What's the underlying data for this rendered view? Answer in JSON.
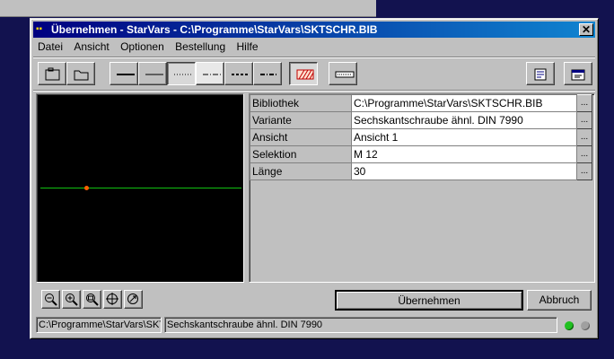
{
  "window": {
    "title": "Übernehmen - StarVars - C:\\Programme\\StarVars\\SKTSCHR.BIB",
    "close_label": "✕"
  },
  "menu": [
    "Datei",
    "Ansicht",
    "Optionen",
    "Bestellung",
    "Hilfe"
  ],
  "toolbar": {
    "buttons": [
      "new-icon",
      "open-icon",
      "line-thick-icon",
      "line-thin-icon",
      "line-dotted-icon",
      "line-dashdot-icon",
      "line-dashed-icon",
      "line-dashdot2-icon",
      "hatch-icon",
      "dimension-icon"
    ],
    "pressed": [
      "line-dotted-icon",
      "hatch-icon"
    ],
    "right_buttons": [
      "export-icon",
      "properties-icon"
    ]
  },
  "viewer": {
    "background": "#000000",
    "line_color": "#10c010",
    "point_color": "#ff6000"
  },
  "properties": [
    {
      "label": "Bibliothek",
      "value": "C:\\Programme\\StarVars\\SKTSCHR.BIB",
      "button": "..."
    },
    {
      "label": "Variante",
      "value": "Sechskantschraube ähnl. DIN 7990",
      "button": "..."
    },
    {
      "label": "Ansicht",
      "value": "Ansicht 1",
      "button": "..."
    },
    {
      "label": "Selektion",
      "value": "M 12",
      "button": "..."
    },
    {
      "label": "Länge",
      "value": "30",
      "button": "..."
    }
  ],
  "zoom_buttons": [
    "zoom-out-icon",
    "zoom-in-icon",
    "zoom-window-icon",
    "zoom-center-icon",
    "zoom-fit-icon"
  ],
  "actions": {
    "apply": "Übernehmen",
    "cancel": "Abbruch"
  },
  "status": {
    "path": "C:\\Programme\\StarVars\\SKTSCHR.BIB",
    "description": "Sechskantschraube ähnl. DIN 7990",
    "led1_color": "#20c020",
    "led2_color": "#a0a0a0"
  },
  "colors": {
    "titlebar_start": "#000080",
    "titlebar_end": "#1084d0",
    "desktop": "#12124f",
    "face": "#c0c0c0"
  }
}
